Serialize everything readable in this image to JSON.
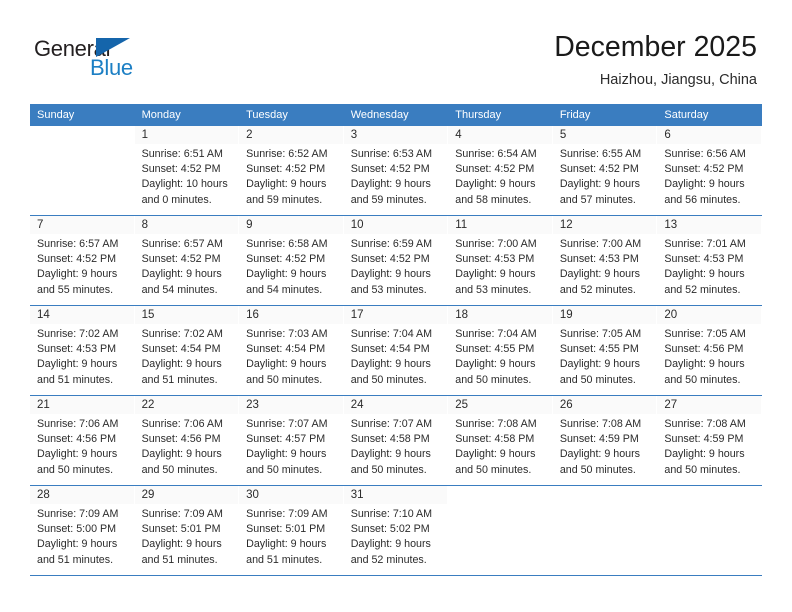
{
  "brand": {
    "name_part1": "General",
    "name_part2": "Blue",
    "accent_color": "#1c7fc4",
    "triangle_color": "#1565ab"
  },
  "header": {
    "title": "December 2025",
    "location": "Haizhou, Jiangsu, China"
  },
  "calendar": {
    "header_bg": "#3a7dc0",
    "weekday_headers": [
      "Sunday",
      "Monday",
      "Tuesday",
      "Wednesday",
      "Thursday",
      "Friday",
      "Saturday"
    ],
    "weeks": [
      [
        {
          "day": "",
          "sunrise": "",
          "sunset": "",
          "daylight1": "",
          "daylight2": ""
        },
        {
          "day": "1",
          "sunrise": "Sunrise: 6:51 AM",
          "sunset": "Sunset: 4:52 PM",
          "daylight1": "Daylight: 10 hours",
          "daylight2": "and 0 minutes."
        },
        {
          "day": "2",
          "sunrise": "Sunrise: 6:52 AM",
          "sunset": "Sunset: 4:52 PM",
          "daylight1": "Daylight: 9 hours",
          "daylight2": "and 59 minutes."
        },
        {
          "day": "3",
          "sunrise": "Sunrise: 6:53 AM",
          "sunset": "Sunset: 4:52 PM",
          "daylight1": "Daylight: 9 hours",
          "daylight2": "and 59 minutes."
        },
        {
          "day": "4",
          "sunrise": "Sunrise: 6:54 AM",
          "sunset": "Sunset: 4:52 PM",
          "daylight1": "Daylight: 9 hours",
          "daylight2": "and 58 minutes."
        },
        {
          "day": "5",
          "sunrise": "Sunrise: 6:55 AM",
          "sunset": "Sunset: 4:52 PM",
          "daylight1": "Daylight: 9 hours",
          "daylight2": "and 57 minutes."
        },
        {
          "day": "6",
          "sunrise": "Sunrise: 6:56 AM",
          "sunset": "Sunset: 4:52 PM",
          "daylight1": "Daylight: 9 hours",
          "daylight2": "and 56 minutes."
        }
      ],
      [
        {
          "day": "7",
          "sunrise": "Sunrise: 6:57 AM",
          "sunset": "Sunset: 4:52 PM",
          "daylight1": "Daylight: 9 hours",
          "daylight2": "and 55 minutes."
        },
        {
          "day": "8",
          "sunrise": "Sunrise: 6:57 AM",
          "sunset": "Sunset: 4:52 PM",
          "daylight1": "Daylight: 9 hours",
          "daylight2": "and 54 minutes."
        },
        {
          "day": "9",
          "sunrise": "Sunrise: 6:58 AM",
          "sunset": "Sunset: 4:52 PM",
          "daylight1": "Daylight: 9 hours",
          "daylight2": "and 54 minutes."
        },
        {
          "day": "10",
          "sunrise": "Sunrise: 6:59 AM",
          "sunset": "Sunset: 4:52 PM",
          "daylight1": "Daylight: 9 hours",
          "daylight2": "and 53 minutes."
        },
        {
          "day": "11",
          "sunrise": "Sunrise: 7:00 AM",
          "sunset": "Sunset: 4:53 PM",
          "daylight1": "Daylight: 9 hours",
          "daylight2": "and 53 minutes."
        },
        {
          "day": "12",
          "sunrise": "Sunrise: 7:00 AM",
          "sunset": "Sunset: 4:53 PM",
          "daylight1": "Daylight: 9 hours",
          "daylight2": "and 52 minutes."
        },
        {
          "day": "13",
          "sunrise": "Sunrise: 7:01 AM",
          "sunset": "Sunset: 4:53 PM",
          "daylight1": "Daylight: 9 hours",
          "daylight2": "and 52 minutes."
        }
      ],
      [
        {
          "day": "14",
          "sunrise": "Sunrise: 7:02 AM",
          "sunset": "Sunset: 4:53 PM",
          "daylight1": "Daylight: 9 hours",
          "daylight2": "and 51 minutes."
        },
        {
          "day": "15",
          "sunrise": "Sunrise: 7:02 AM",
          "sunset": "Sunset: 4:54 PM",
          "daylight1": "Daylight: 9 hours",
          "daylight2": "and 51 minutes."
        },
        {
          "day": "16",
          "sunrise": "Sunrise: 7:03 AM",
          "sunset": "Sunset: 4:54 PM",
          "daylight1": "Daylight: 9 hours",
          "daylight2": "and 50 minutes."
        },
        {
          "day": "17",
          "sunrise": "Sunrise: 7:04 AM",
          "sunset": "Sunset: 4:54 PM",
          "daylight1": "Daylight: 9 hours",
          "daylight2": "and 50 minutes."
        },
        {
          "day": "18",
          "sunrise": "Sunrise: 7:04 AM",
          "sunset": "Sunset: 4:55 PM",
          "daylight1": "Daylight: 9 hours",
          "daylight2": "and 50 minutes."
        },
        {
          "day": "19",
          "sunrise": "Sunrise: 7:05 AM",
          "sunset": "Sunset: 4:55 PM",
          "daylight1": "Daylight: 9 hours",
          "daylight2": "and 50 minutes."
        },
        {
          "day": "20",
          "sunrise": "Sunrise: 7:05 AM",
          "sunset": "Sunset: 4:56 PM",
          "daylight1": "Daylight: 9 hours",
          "daylight2": "and 50 minutes."
        }
      ],
      [
        {
          "day": "21",
          "sunrise": "Sunrise: 7:06 AM",
          "sunset": "Sunset: 4:56 PM",
          "daylight1": "Daylight: 9 hours",
          "daylight2": "and 50 minutes."
        },
        {
          "day": "22",
          "sunrise": "Sunrise: 7:06 AM",
          "sunset": "Sunset: 4:56 PM",
          "daylight1": "Daylight: 9 hours",
          "daylight2": "and 50 minutes."
        },
        {
          "day": "23",
          "sunrise": "Sunrise: 7:07 AM",
          "sunset": "Sunset: 4:57 PM",
          "daylight1": "Daylight: 9 hours",
          "daylight2": "and 50 minutes."
        },
        {
          "day": "24",
          "sunrise": "Sunrise: 7:07 AM",
          "sunset": "Sunset: 4:58 PM",
          "daylight1": "Daylight: 9 hours",
          "daylight2": "and 50 minutes."
        },
        {
          "day": "25",
          "sunrise": "Sunrise: 7:08 AM",
          "sunset": "Sunset: 4:58 PM",
          "daylight1": "Daylight: 9 hours",
          "daylight2": "and 50 minutes."
        },
        {
          "day": "26",
          "sunrise": "Sunrise: 7:08 AM",
          "sunset": "Sunset: 4:59 PM",
          "daylight1": "Daylight: 9 hours",
          "daylight2": "and 50 minutes."
        },
        {
          "day": "27",
          "sunrise": "Sunrise: 7:08 AM",
          "sunset": "Sunset: 4:59 PM",
          "daylight1": "Daylight: 9 hours",
          "daylight2": "and 50 minutes."
        }
      ],
      [
        {
          "day": "28",
          "sunrise": "Sunrise: 7:09 AM",
          "sunset": "Sunset: 5:00 PM",
          "daylight1": "Daylight: 9 hours",
          "daylight2": "and 51 minutes."
        },
        {
          "day": "29",
          "sunrise": "Sunrise: 7:09 AM",
          "sunset": "Sunset: 5:01 PM",
          "daylight1": "Daylight: 9 hours",
          "daylight2": "and 51 minutes."
        },
        {
          "day": "30",
          "sunrise": "Sunrise: 7:09 AM",
          "sunset": "Sunset: 5:01 PM",
          "daylight1": "Daylight: 9 hours",
          "daylight2": "and 51 minutes."
        },
        {
          "day": "31",
          "sunrise": "Sunrise: 7:10 AM",
          "sunset": "Sunset: 5:02 PM",
          "daylight1": "Daylight: 9 hours",
          "daylight2": "and 52 minutes."
        },
        {
          "day": "",
          "sunrise": "",
          "sunset": "",
          "daylight1": "",
          "daylight2": ""
        },
        {
          "day": "",
          "sunrise": "",
          "sunset": "",
          "daylight1": "",
          "daylight2": ""
        },
        {
          "day": "",
          "sunrise": "",
          "sunset": "",
          "daylight1": "",
          "daylight2": ""
        }
      ]
    ]
  }
}
